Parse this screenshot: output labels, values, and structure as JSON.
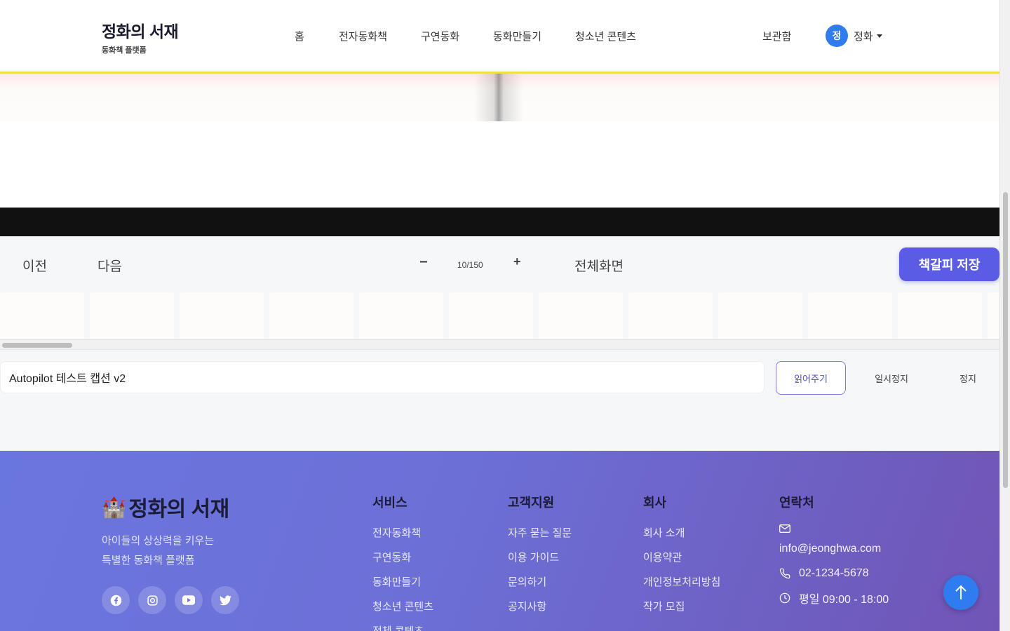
{
  "header": {
    "brand_title": "정화의 서재",
    "brand_subtitle": "동화책 플랫폼",
    "nav": [
      "홈",
      "전자동화책",
      "구연동화",
      "동화만들기",
      "청소년 콘텐츠"
    ],
    "library": "보관함",
    "user": {
      "avatar_initial": "정",
      "name": "정화"
    }
  },
  "viewer": {
    "prev_label": "이전",
    "next_label": "다음",
    "zoom_out": "−",
    "zoom_in": "+",
    "page_indicator": "10/150",
    "fullscreen_label": "전체화면",
    "save_bookmark_label": "책갈피 저장",
    "thumbnail_count": 12
  },
  "caption": {
    "text": "Autopilot 테스트 캡션 v2",
    "read_label": "읽어주기",
    "pause_label": "일시정지",
    "stop_label": "정지"
  },
  "footer": {
    "logo_emoji": "🏰",
    "logo_text": "정화의 서재",
    "tagline_line1": "아이들의 상상력을 키우는",
    "tagline_line2": "특별한 동화책 플랫폼",
    "social": [
      "facebook-icon",
      "instagram-icon",
      "youtube-icon",
      "twitter-icon"
    ],
    "columns": [
      {
        "title": "서비스",
        "links": [
          "전자동화책",
          "구연동화",
          "동화만들기",
          "청소년 콘텐츠",
          "전체 콘텐츠"
        ]
      },
      {
        "title": "고객지원",
        "links": [
          "자주 묻는 질문",
          "이용 가이드",
          "문의하기",
          "공지사항"
        ]
      },
      {
        "title": "회사",
        "links": [
          "회사 소개",
          "이용약관",
          "개인정보처리방침",
          "작가 모집"
        ]
      }
    ],
    "contact": {
      "title": "연락처",
      "email": "info@jeonghwa.com",
      "phone": "02-1234-5678",
      "hours": "평일 09:00 - 18:00"
    }
  },
  "colors": {
    "accent": "#5a5ce6",
    "header_underline": "#f5dc4a",
    "avatar": "#2f7bf0",
    "footer_start": "#6a76df",
    "footer_end": "#7055b6"
  }
}
